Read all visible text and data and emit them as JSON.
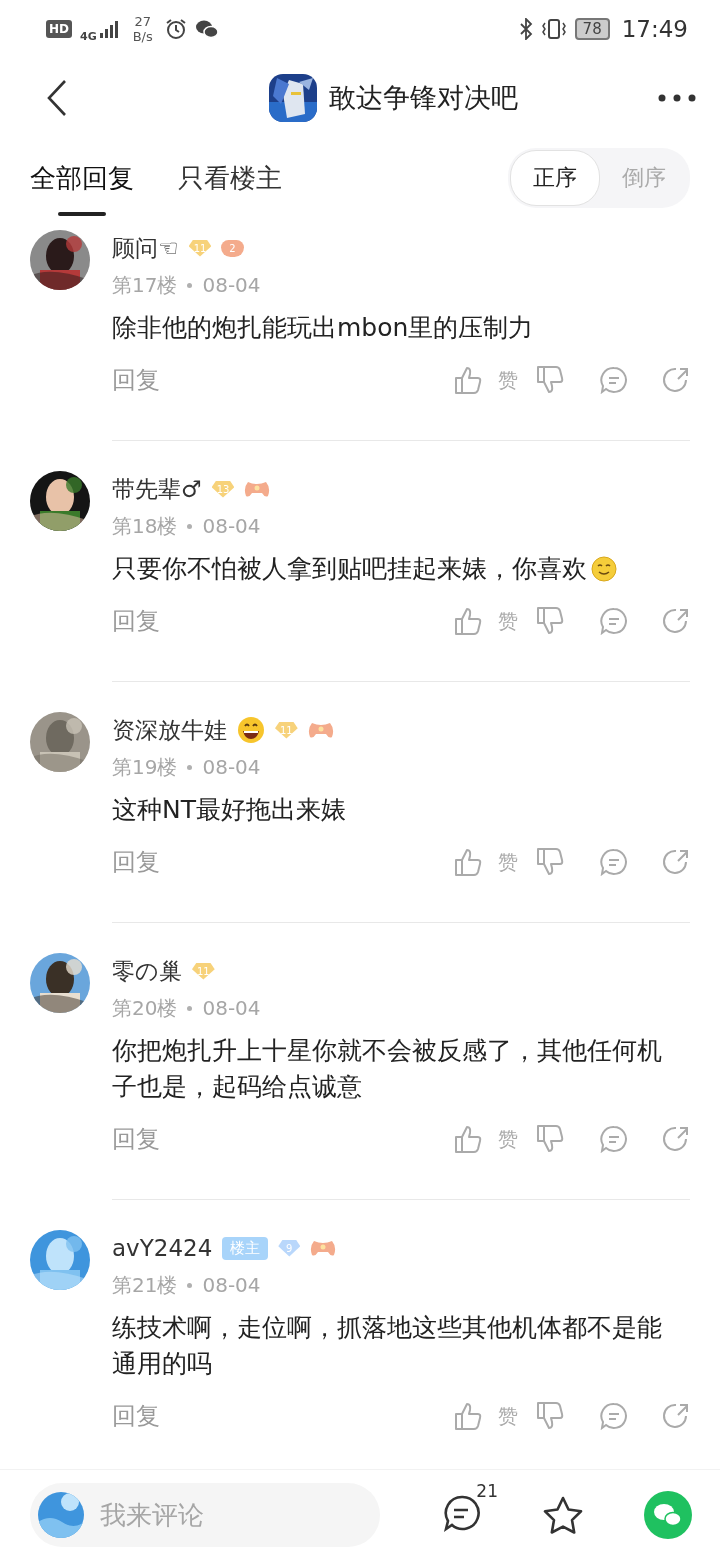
{
  "status_bar": {
    "hd": "HD",
    "network": "4G",
    "speed_value": "27",
    "speed_unit": "B/s",
    "battery": "78",
    "time": "17:49"
  },
  "header": {
    "title": "敢达争锋对决吧"
  },
  "tabs": [
    {
      "label": "全部回复",
      "selected": true
    },
    {
      "label": "只看楼主",
      "selected": false
    }
  ],
  "sort": [
    {
      "label": "正序",
      "selected": true
    },
    {
      "label": "倒序",
      "selected": false
    }
  ],
  "comments": [
    {
      "name": "顾问☜",
      "badges": [
        {
          "kind": "level",
          "text": "11",
          "color": "#f7d27a"
        },
        {
          "kind": "game",
          "text": "2"
        }
      ],
      "floor": "第17楼",
      "date": "08-04",
      "text": "除非他的炮扎能玩出mbon里的压制力",
      "reply": "回复",
      "like": "赞"
    },
    {
      "name": "带先辈♂",
      "badges": [
        {
          "kind": "level",
          "text": "13",
          "color": "#f7d27a"
        },
        {
          "kind": "game"
        }
      ],
      "floor": "第18楼",
      "date": "08-04",
      "text": "只要你不怕被人拿到贴吧挂起来婊，你喜欢",
      "text_emoji": true,
      "reply": "回复",
      "like": "赞"
    },
    {
      "name": "资深放牛娃",
      "name_emoji": true,
      "badges": [
        {
          "kind": "level",
          "text": "11",
          "color": "#f7d27a"
        },
        {
          "kind": "game"
        }
      ],
      "floor": "第19楼",
      "date": "08-04",
      "text": "这种NT最好拖出来婊",
      "reply": "回复",
      "like": "赞"
    },
    {
      "name": "零の巢",
      "badges": [
        {
          "kind": "level",
          "text": "11",
          "color": "#f7d27a"
        }
      ],
      "floor": "第20楼",
      "date": "08-04",
      "text": "你把炮扎升上十星你就不会被反感了，其他任何机子也是，起码给点诚意",
      "reply": "回复",
      "like": "赞"
    },
    {
      "name": "avY2424",
      "op_label": "楼主",
      "badges": [
        {
          "kind": "level",
          "text": "9",
          "color": "#b9d7fb"
        },
        {
          "kind": "game"
        }
      ],
      "floor": "第21楼",
      "date": "08-04",
      "text": "练技术啊，走位啊，抓落地这些其他机体都不是能通用的吗",
      "reply": "回复",
      "like": "赞"
    }
  ],
  "bottom_bar": {
    "placeholder": "我来评论",
    "comment_count": "21"
  }
}
